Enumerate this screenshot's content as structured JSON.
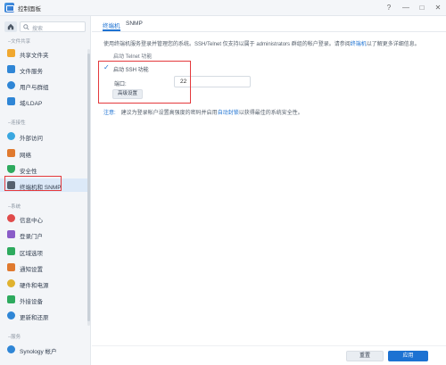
{
  "window": {
    "title": "控制面板",
    "help_label": "?",
    "minimize_label": "—",
    "maximize_label": "□",
    "close_label": "✕"
  },
  "sidebar": {
    "search_placeholder": "搜索",
    "sections": [
      {
        "label": "文件共享",
        "items": [
          {
            "label": "共享文件夹",
            "icon": "shared-folder-icon",
            "color": "#f0a830"
          },
          {
            "label": "文件服务",
            "icon": "file-services-icon",
            "color": "#2f86d6"
          },
          {
            "label": "用户与群组",
            "icon": "user-group-icon",
            "color": "#2f86d6"
          },
          {
            "label": "域/LDAP",
            "icon": "domain-ldap-icon",
            "color": "#2f86d6"
          }
        ]
      },
      {
        "label": "连接性",
        "items": [
          {
            "label": "外部访问",
            "icon": "external-access-icon",
            "color": "#3aa7e0"
          },
          {
            "label": "网络",
            "icon": "network-icon",
            "color": "#e07a2f"
          },
          {
            "label": "安全性",
            "icon": "security-icon",
            "color": "#2eaa5e"
          },
          {
            "label": "终端机和 SNMP",
            "icon": "terminal-icon",
            "color": "#55606e",
            "active": true
          }
        ]
      },
      {
        "label": "系统",
        "items": [
          {
            "label": "信息中心",
            "icon": "info-center-icon",
            "color": "#e04b4b"
          },
          {
            "label": "登录门户",
            "icon": "login-portal-icon",
            "color": "#8a5cc8"
          },
          {
            "label": "区域选项",
            "icon": "regional-options-icon",
            "color": "#2eaa5e"
          },
          {
            "label": "通知设置",
            "icon": "notification-icon",
            "color": "#e07a2f"
          },
          {
            "label": "硬件和电源",
            "icon": "hardware-power-icon",
            "color": "#e0b22f"
          },
          {
            "label": "外接设备",
            "icon": "external-devices-icon",
            "color": "#2eaa5e"
          },
          {
            "label": "更新和还原",
            "icon": "update-restore-icon",
            "color": "#2f86d6"
          }
        ]
      },
      {
        "label": "服务",
        "items": [
          {
            "label": "Synology 帐户",
            "icon": "synology-account-icon",
            "color": "#2f86d6"
          }
        ]
      }
    ]
  },
  "tabs": [
    {
      "label": "终端机",
      "active": true
    },
    {
      "label": "SNMP",
      "active": false
    }
  ],
  "main": {
    "description_pre": "使用终端机服务登录并管理您的系统。SSH/Telnet 仅支持以属于 administrators 群组的帐户登录。请参阅",
    "description_link": "终端机",
    "description_post": "以了解更多详细信息。",
    "telnet_label": "启动 Telnet 功能",
    "telnet_checked": false,
    "ssh_label": "启动 SSH 功能",
    "ssh_checked": true,
    "port_label": "端口:",
    "port_value": "22",
    "advanced_button": "高级设置",
    "note_tag": "注意:",
    "note_pre": "建议为登录帐户设置高强度的密码并启用",
    "note_link": "自动封锁",
    "note_post": "以获得最佳的系统安全性。"
  },
  "footer": {
    "reset_label": "重置",
    "apply_label": "应用"
  },
  "colors": {
    "accent": "#1d72d2",
    "highlight": "#e4393c"
  }
}
